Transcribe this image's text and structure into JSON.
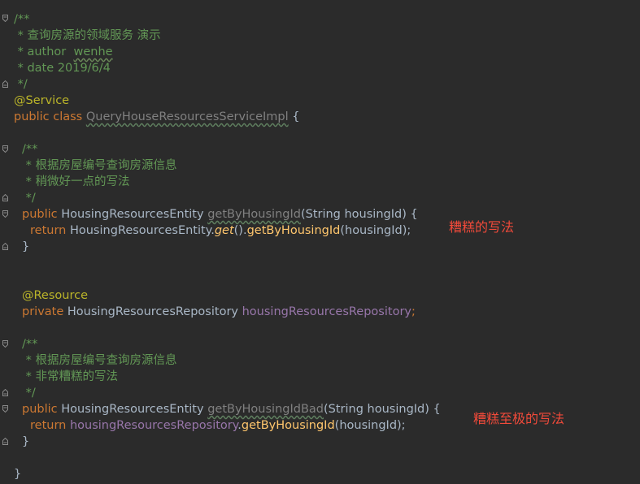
{
  "code": {
    "l1": "/**",
    "l2": " * 查询房源的领域服务 演示",
    "l3_prefix": " * author  ",
    "l3_name": "wenhe",
    "l4": " * date 2019/6/4",
    "l5": " */",
    "l6": "@Service",
    "l7_kw": "public class ",
    "l7_name": "QueryHouseResourcesServiceImpl",
    "l7_rest": " {",
    "l8": "/**",
    "l9": " * 根据房屋编号查询房源信息",
    "l10": " * 稍微好一点的写法",
    "l11": " */",
    "l12_kw": "public ",
    "l12_type": "HousingResourcesEntity ",
    "l12_name": "getByHousingId",
    "l12_rest": "(String housingId) {",
    "l13_kw": "return ",
    "l13_type": "HousingResourcesEntity.",
    "l13_get": "get",
    "l13_mid": "().",
    "l13_call": "getByHousingId",
    "l13_rest": "(housingId);",
    "l14": "}",
    "l15": "@Resource",
    "l16_kw": "private ",
    "l16_type": "HousingResourcesRepository ",
    "l16_field": "housingResourcesRepository",
    "l16_semi": ";",
    "l17": "/**",
    "l18": " * 根据房屋编号查询房源信息",
    "l19": " * 非常糟糕的写法",
    "l20": " */",
    "l21_kw": "public ",
    "l21_type": "HousingResourcesEntity ",
    "l21_name": "getByHousingIdBad",
    "l21_rest": "(String housingId) {",
    "l22_kw": "return ",
    "l22_field": "housingResourcesRepository",
    "l22_dot": ".",
    "l22_call": "getByHousingId",
    "l22_rest": "(housingId);",
    "l23": "}",
    "l24": "}"
  },
  "annotations": {
    "note1": "糟糕的写法",
    "note2": "糟糕至极的写法"
  },
  "colors": {
    "background": "#2b2b2b",
    "comment": "#629755",
    "keyword": "#cc7832",
    "annotation": "#bbb529",
    "field": "#9876aa",
    "default_text": "#a9b7c6",
    "note_red": "#f04a3a"
  }
}
